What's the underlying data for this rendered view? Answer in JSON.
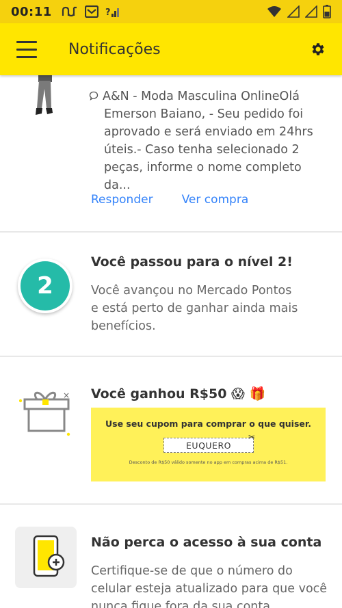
{
  "status_bar": {
    "time": "00:11"
  },
  "header": {
    "title": "Notificações"
  },
  "notifications": [
    {
      "message_lines": [
        "A&N - Moda Masculina OnlineOlá",
        "Emerson Baiano,  - Seu pedido foi",
        "aprovado e será enviado em 24hrs",
        "úteis.- Caso tenha selecionado 2",
        "peças, informe o nome completo da..."
      ],
      "actions": {
        "reply": "Responder",
        "view_purchase": "Ver compra"
      }
    },
    {
      "badge": "2",
      "title": "Você passou para o nível 2!",
      "body_lines": [
        "Você avançou no Mercado Pontos",
        "e está perto de ganhar ainda mais",
        "benefícios."
      ]
    },
    {
      "title": "Você ganhou R$50 😱 🎁",
      "coupon": {
        "title": "Use seu cupom para comprar o que quiser.",
        "code": "EUQUERO",
        "note": "Desconto de R$50 válido somente no app em compras acima de R$51."
      }
    },
    {
      "title": "Não perca o acesso à sua conta",
      "body_lines": [
        "Certifique-se de que o número do",
        "celular esteja atualizado para que você",
        "nunca fique fora da sua conta."
      ]
    }
  ],
  "colors": {
    "brand_yellow": "#ffe600",
    "link_blue": "#3483fa",
    "level_teal": "#25bba8",
    "coupon_yellow": "#fff159"
  }
}
